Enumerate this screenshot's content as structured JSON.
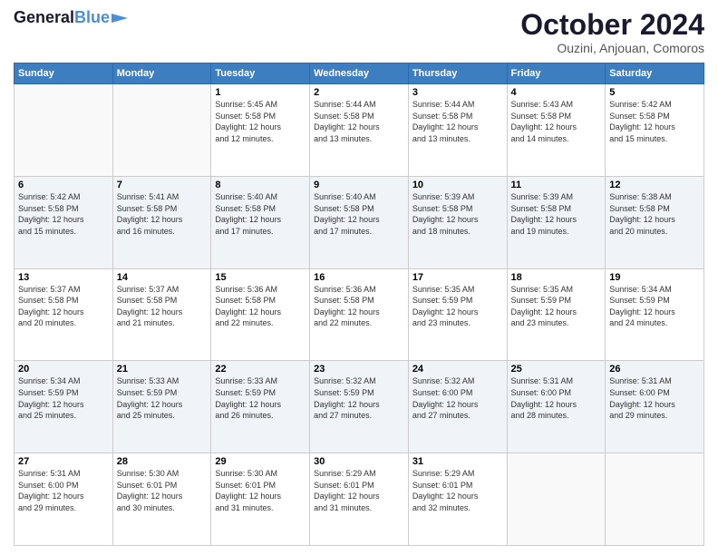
{
  "header": {
    "logo_line1": "General",
    "logo_line2": "Blue",
    "month": "October 2024",
    "location": "Ouzini, Anjouan, Comoros"
  },
  "days_of_week": [
    "Sunday",
    "Monday",
    "Tuesday",
    "Wednesday",
    "Thursday",
    "Friday",
    "Saturday"
  ],
  "weeks": [
    [
      {
        "day": "",
        "info": ""
      },
      {
        "day": "",
        "info": ""
      },
      {
        "day": "1",
        "info": "Sunrise: 5:45 AM\nSunset: 5:58 PM\nDaylight: 12 hours\nand 12 minutes."
      },
      {
        "day": "2",
        "info": "Sunrise: 5:44 AM\nSunset: 5:58 PM\nDaylight: 12 hours\nand 13 minutes."
      },
      {
        "day": "3",
        "info": "Sunrise: 5:44 AM\nSunset: 5:58 PM\nDaylight: 12 hours\nand 13 minutes."
      },
      {
        "day": "4",
        "info": "Sunrise: 5:43 AM\nSunset: 5:58 PM\nDaylight: 12 hours\nand 14 minutes."
      },
      {
        "day": "5",
        "info": "Sunrise: 5:42 AM\nSunset: 5:58 PM\nDaylight: 12 hours\nand 15 minutes."
      }
    ],
    [
      {
        "day": "6",
        "info": "Sunrise: 5:42 AM\nSunset: 5:58 PM\nDaylight: 12 hours\nand 15 minutes."
      },
      {
        "day": "7",
        "info": "Sunrise: 5:41 AM\nSunset: 5:58 PM\nDaylight: 12 hours\nand 16 minutes."
      },
      {
        "day": "8",
        "info": "Sunrise: 5:40 AM\nSunset: 5:58 PM\nDaylight: 12 hours\nand 17 minutes."
      },
      {
        "day": "9",
        "info": "Sunrise: 5:40 AM\nSunset: 5:58 PM\nDaylight: 12 hours\nand 17 minutes."
      },
      {
        "day": "10",
        "info": "Sunrise: 5:39 AM\nSunset: 5:58 PM\nDaylight: 12 hours\nand 18 minutes."
      },
      {
        "day": "11",
        "info": "Sunrise: 5:39 AM\nSunset: 5:58 PM\nDaylight: 12 hours\nand 19 minutes."
      },
      {
        "day": "12",
        "info": "Sunrise: 5:38 AM\nSunset: 5:58 PM\nDaylight: 12 hours\nand 20 minutes."
      }
    ],
    [
      {
        "day": "13",
        "info": "Sunrise: 5:37 AM\nSunset: 5:58 PM\nDaylight: 12 hours\nand 20 minutes."
      },
      {
        "day": "14",
        "info": "Sunrise: 5:37 AM\nSunset: 5:58 PM\nDaylight: 12 hours\nand 21 minutes."
      },
      {
        "day": "15",
        "info": "Sunrise: 5:36 AM\nSunset: 5:58 PM\nDaylight: 12 hours\nand 22 minutes."
      },
      {
        "day": "16",
        "info": "Sunrise: 5:36 AM\nSunset: 5:58 PM\nDaylight: 12 hours\nand 22 minutes."
      },
      {
        "day": "17",
        "info": "Sunrise: 5:35 AM\nSunset: 5:59 PM\nDaylight: 12 hours\nand 23 minutes."
      },
      {
        "day": "18",
        "info": "Sunrise: 5:35 AM\nSunset: 5:59 PM\nDaylight: 12 hours\nand 23 minutes."
      },
      {
        "day": "19",
        "info": "Sunrise: 5:34 AM\nSunset: 5:59 PM\nDaylight: 12 hours\nand 24 minutes."
      }
    ],
    [
      {
        "day": "20",
        "info": "Sunrise: 5:34 AM\nSunset: 5:59 PM\nDaylight: 12 hours\nand 25 minutes."
      },
      {
        "day": "21",
        "info": "Sunrise: 5:33 AM\nSunset: 5:59 PM\nDaylight: 12 hours\nand 25 minutes."
      },
      {
        "day": "22",
        "info": "Sunrise: 5:33 AM\nSunset: 5:59 PM\nDaylight: 12 hours\nand 26 minutes."
      },
      {
        "day": "23",
        "info": "Sunrise: 5:32 AM\nSunset: 5:59 PM\nDaylight: 12 hours\nand 27 minutes."
      },
      {
        "day": "24",
        "info": "Sunrise: 5:32 AM\nSunset: 6:00 PM\nDaylight: 12 hours\nand 27 minutes."
      },
      {
        "day": "25",
        "info": "Sunrise: 5:31 AM\nSunset: 6:00 PM\nDaylight: 12 hours\nand 28 minutes."
      },
      {
        "day": "26",
        "info": "Sunrise: 5:31 AM\nSunset: 6:00 PM\nDaylight: 12 hours\nand 29 minutes."
      }
    ],
    [
      {
        "day": "27",
        "info": "Sunrise: 5:31 AM\nSunset: 6:00 PM\nDaylight: 12 hours\nand 29 minutes."
      },
      {
        "day": "28",
        "info": "Sunrise: 5:30 AM\nSunset: 6:01 PM\nDaylight: 12 hours\nand 30 minutes."
      },
      {
        "day": "29",
        "info": "Sunrise: 5:30 AM\nSunset: 6:01 PM\nDaylight: 12 hours\nand 31 minutes."
      },
      {
        "day": "30",
        "info": "Sunrise: 5:29 AM\nSunset: 6:01 PM\nDaylight: 12 hours\nand 31 minutes."
      },
      {
        "day": "31",
        "info": "Sunrise: 5:29 AM\nSunset: 6:01 PM\nDaylight: 12 hours\nand 32 minutes."
      },
      {
        "day": "",
        "info": ""
      },
      {
        "day": "",
        "info": ""
      }
    ]
  ]
}
